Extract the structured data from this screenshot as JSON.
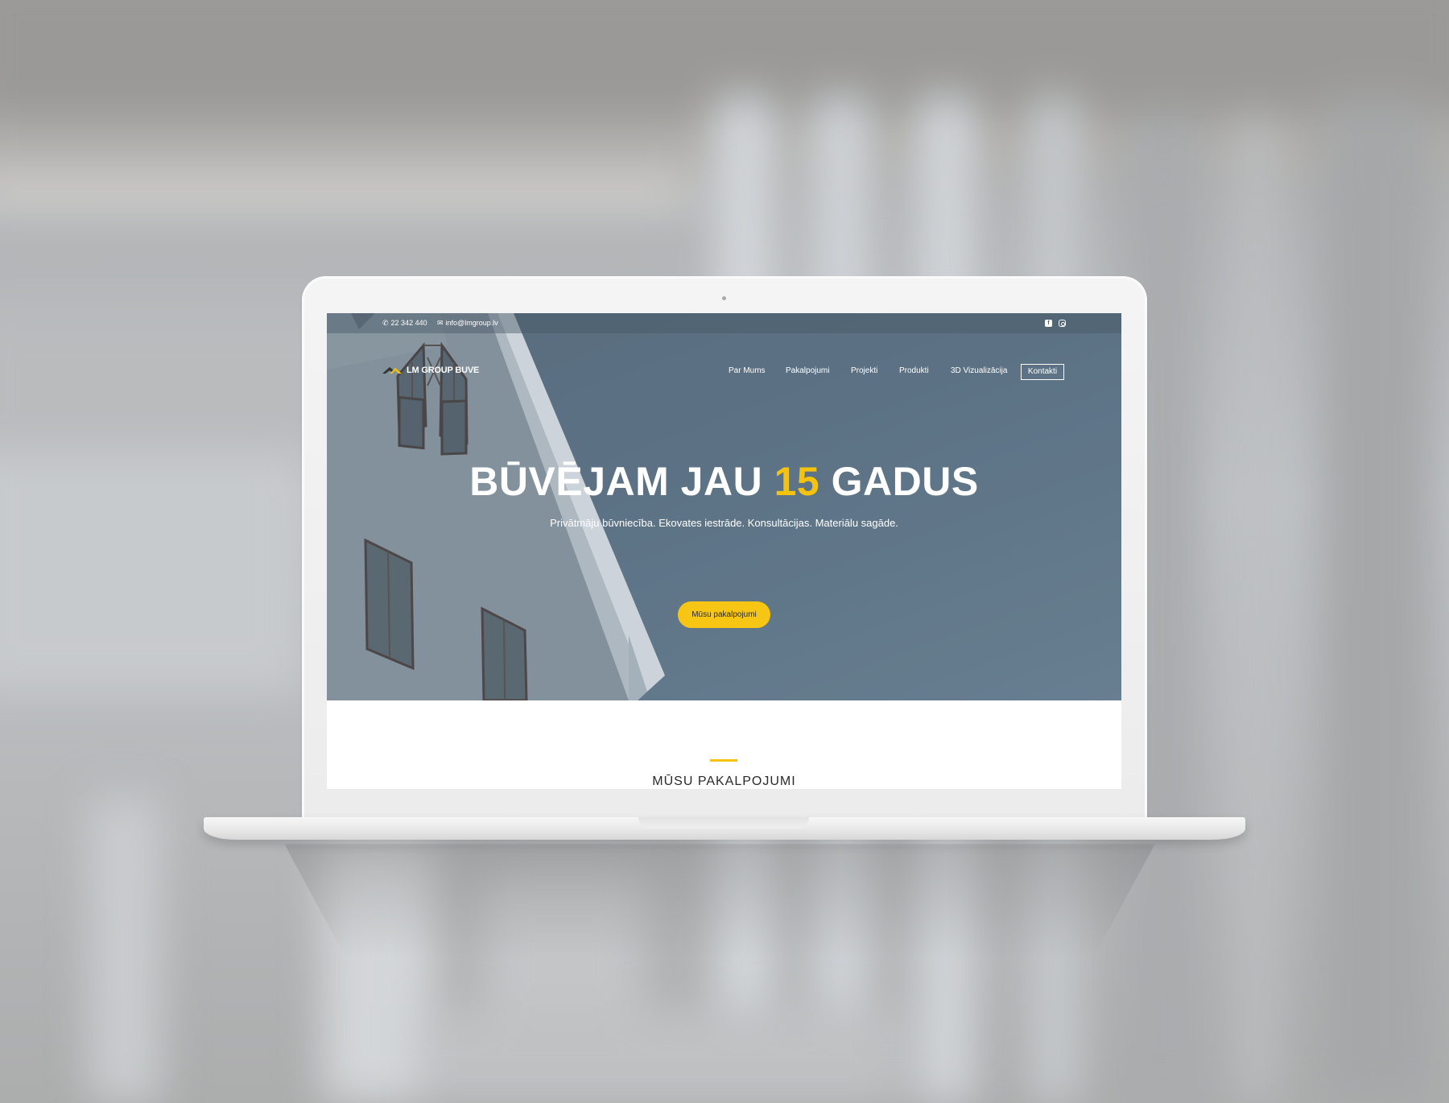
{
  "topbar": {
    "phone_icon": "phone-icon",
    "phone": "22 342 440",
    "email_icon": "envelope-icon",
    "email": "info@lmgroup.lv",
    "social": [
      {
        "icon": "facebook-icon"
      },
      {
        "icon": "instagram-icon"
      }
    ]
  },
  "logo": {
    "text": "LM GROUP BUVE",
    "icon": "roof-logo-icon"
  },
  "nav": {
    "items": [
      {
        "label": "Par Mums"
      },
      {
        "label": "Pakalpojumi"
      },
      {
        "label": "Projekti"
      },
      {
        "label": "Produkti"
      },
      {
        "label": "3D Vizualizācija"
      }
    ],
    "cta_label": "Kontakti"
  },
  "hero": {
    "title_before": "BŪVĒJAM JAU ",
    "title_accent": "15",
    "title_after": " GADUS",
    "subtitle": "Privātmāju būvniecība. Ekovates iestrāde. Konsultācijas. Materiālu sagāde.",
    "button_label": "Mūsu pakalpojumi"
  },
  "section": {
    "title": "MŪSU PAKALPOJUMI"
  },
  "colors": {
    "accent": "#f5c20e",
    "hero_overlay": "#62788a",
    "device": "#f1f1f1"
  }
}
